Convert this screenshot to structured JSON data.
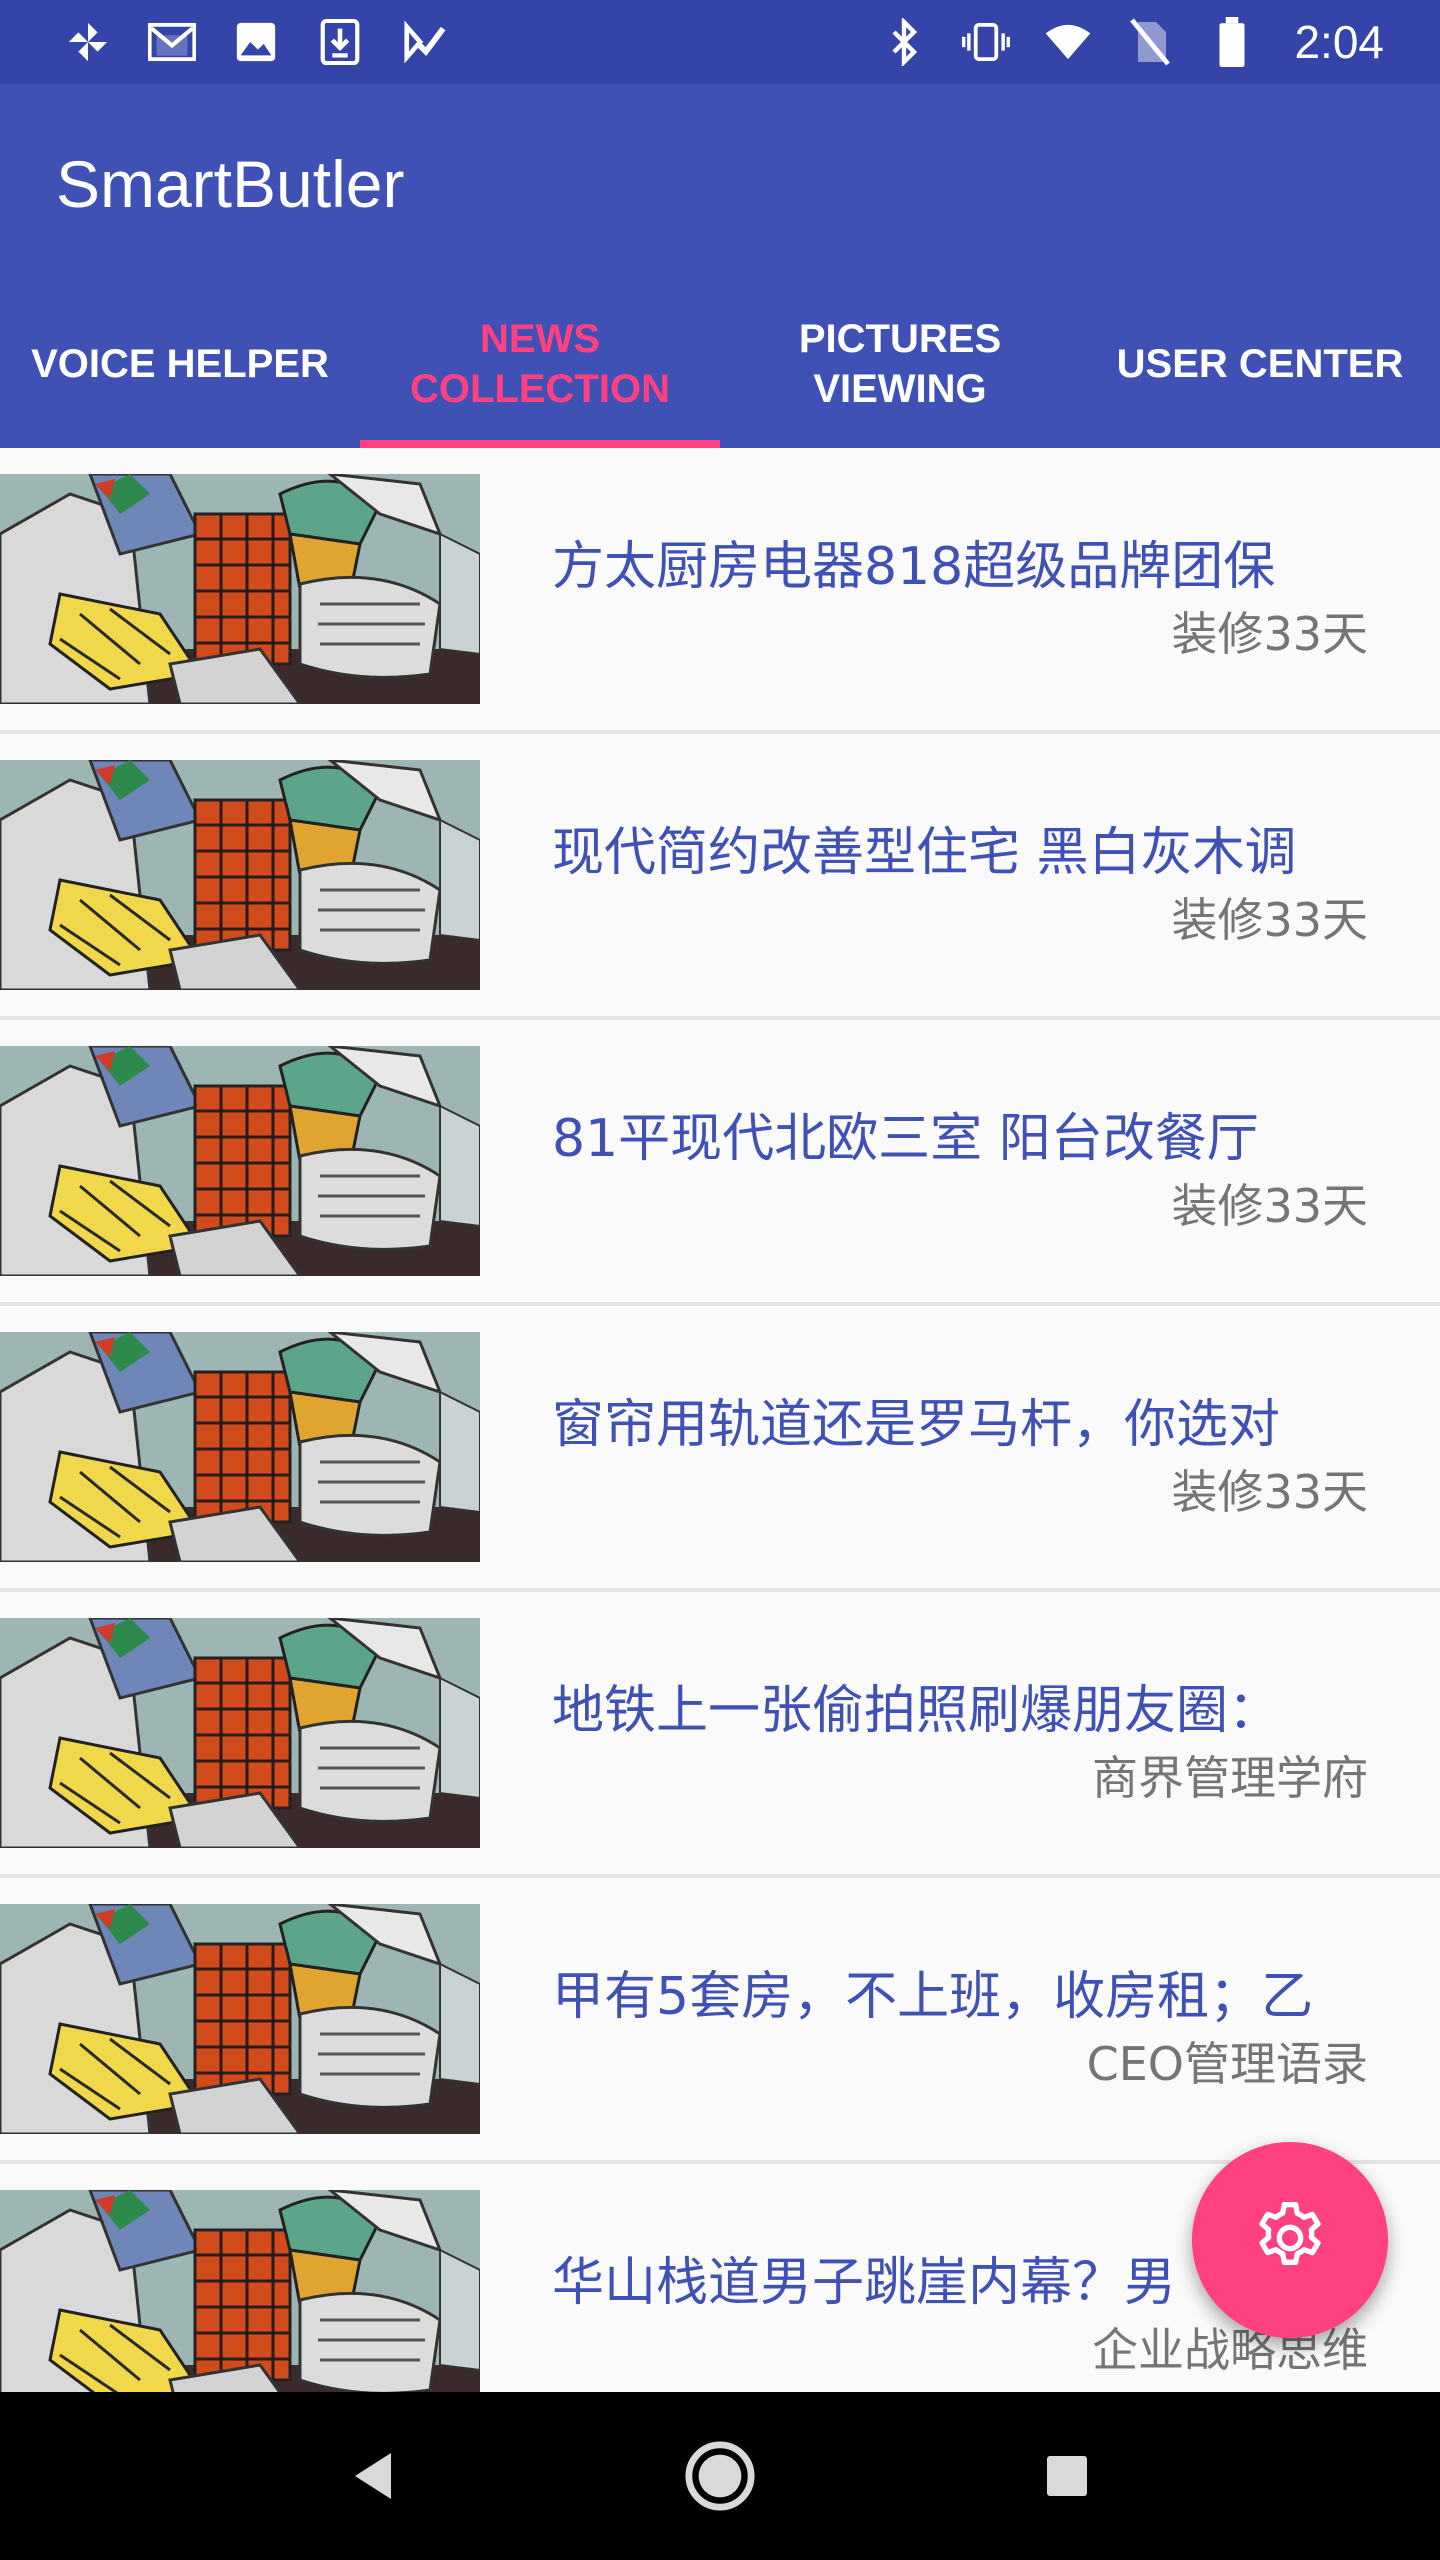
{
  "status_bar": {
    "time": "2:04",
    "left_icons": [
      "pinwheel-icon",
      "gmail-icon",
      "image-icon",
      "download-icon",
      "task-icon"
    ],
    "right_icons": [
      "bluetooth-icon",
      "vibrate-icon",
      "wifi-icon",
      "no-sim-icon",
      "battery-icon"
    ]
  },
  "app_bar": {
    "title": "SmartButler",
    "color": "#3f51b5"
  },
  "tabs": [
    {
      "label": "VOICE HELPER",
      "active": false
    },
    {
      "label": "NEWS COLLECTION",
      "active": true
    },
    {
      "label": "PICTURES VIEWING",
      "active": false
    },
    {
      "label": "USER CENTER",
      "active": false
    }
  ],
  "accent_color": "#ff4081",
  "news": [
    {
      "title": "方太厨房电器818超级品牌团保",
      "source": "装修33天",
      "thumbnail": "painting-thumbnail"
    },
    {
      "title": "现代简约改善型住宅 黑白灰木调",
      "source": "装修33天",
      "thumbnail": "painting-thumbnail"
    },
    {
      "title": "81平现代北欧三室 阳台改餐厅",
      "source": "装修33天",
      "thumbnail": "painting-thumbnail"
    },
    {
      "title": "窗帘用轨道还是罗马杆，你选对",
      "source": "装修33天",
      "thumbnail": "painting-thumbnail"
    },
    {
      "title": "地铁上一张偷拍照刷爆朋友圈：",
      "source": "商界管理学府",
      "thumbnail": "painting-thumbnail"
    },
    {
      "title": "甲有5套房，不上班，收房租；乙",
      "source": "CEO管理语录",
      "thumbnail": "painting-thumbnail"
    },
    {
      "title": "华山栈道男子跳崖内幕？男",
      "source": "企业战略思维",
      "thumbnail": "painting-thumbnail"
    }
  ],
  "fab": {
    "icon": "settings-gear-icon"
  },
  "nav_bar": {
    "buttons": [
      "back-icon",
      "home-icon",
      "recents-icon"
    ]
  }
}
